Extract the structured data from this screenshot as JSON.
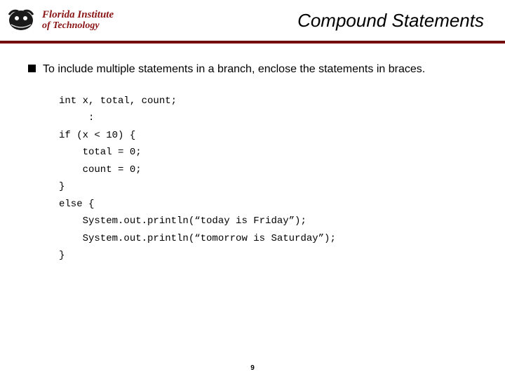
{
  "header": {
    "institution_line1": "Florida Institute",
    "institution_line2": "of Technology",
    "slide_title": "Compound Statements"
  },
  "bullet": {
    "text": "To include multiple statements in a branch, enclose the statements in braces."
  },
  "code": {
    "lines": [
      "int x, total, count;",
      "     :",
      "if (x < 10) {",
      "    total = 0;",
      "    count = 0;",
      "}",
      "else {",
      "    System.out.println(“today is Friday”);",
      "    System.out.println(“tomorrow is Saturday”);",
      "}"
    ]
  },
  "page_number": "9"
}
